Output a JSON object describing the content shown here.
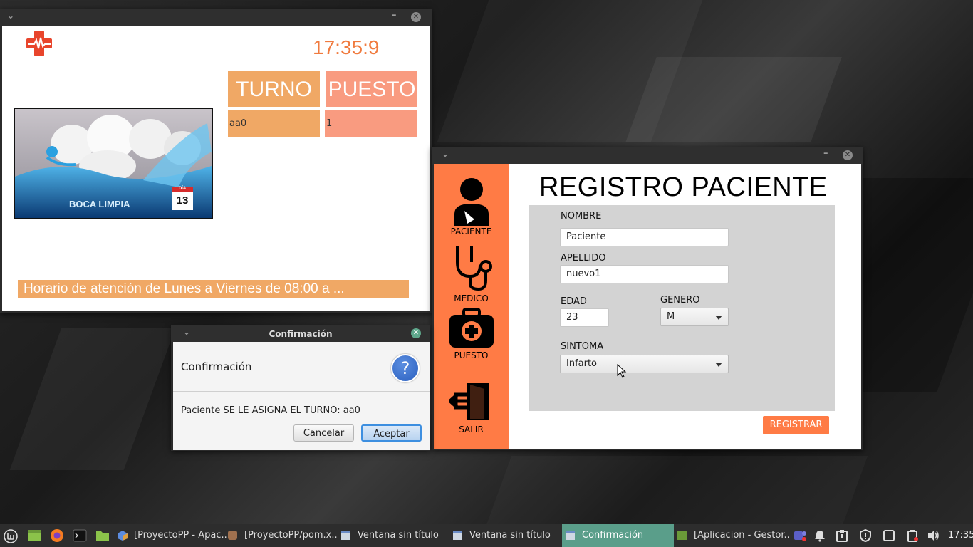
{
  "display_window": {
    "clock": "17:35:9",
    "headers": {
      "turno": "TURNO",
      "puesto": "PUESTO"
    },
    "rows": [
      {
        "turno": "aa0",
        "puesto": "1"
      }
    ],
    "video_caption": "BOCA LIMPIA",
    "video_badge_top": "DÍA",
    "video_badge_day": "13",
    "ticker": "Horario de atención de Lunes a Viernes de 08:00 a ..."
  },
  "register_window": {
    "title": "REGISTRO PACIENTE",
    "sidebar": [
      {
        "label": "PACIENTE",
        "icon": "patient-icon"
      },
      {
        "label": "MEDICO",
        "icon": "stethoscope-icon"
      },
      {
        "label": "PUESTO",
        "icon": "medical-kit-icon"
      },
      {
        "label": "SALIR",
        "icon": "exit-icon"
      }
    ],
    "form": {
      "nombre_label": "NOMBRE",
      "nombre_value": "Paciente",
      "apellido_label": "APELLIDO",
      "apellido_value": "nuevo1",
      "edad_label": "EDAD",
      "edad_value": "23",
      "genero_label": "GENERO",
      "genero_value": "M",
      "sintoma_label": "SINTOMA",
      "sintoma_value": "Infarto"
    },
    "register_button": "REGISTRAR",
    "accent_color": "#ff7b45"
  },
  "dialog": {
    "window_title": "Confirmación",
    "header": "Confirmación",
    "message": "Paciente SE LE ASIGNA EL TURNO: aa0",
    "cancel": "Cancelar",
    "accept": "Aceptar"
  },
  "taskbar": {
    "tasks": [
      {
        "label": "[ProyectoPP - Apac..."
      },
      {
        "label": "[ProyectoPP/pom.x..."
      },
      {
        "label": "Ventana sin título"
      },
      {
        "label": "Ventana sin título"
      },
      {
        "label": "Confirmación"
      },
      {
        "label": "[Aplicacion - Gestor..."
      }
    ],
    "clock": "17:35"
  }
}
